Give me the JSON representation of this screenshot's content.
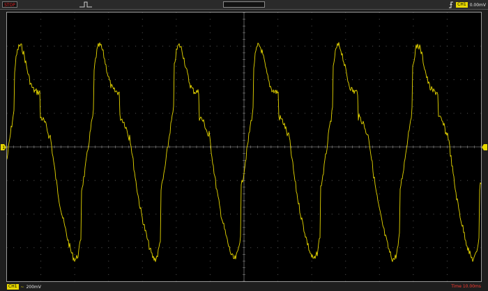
{
  "topbar": {
    "run_state": "STOP",
    "trigger_source": "CH1",
    "trigger_level": "0.00mV",
    "trigger_edge_icon": "rising-edge-icon",
    "trigger_shape_icon": "pulse-icon"
  },
  "bottombar": {
    "channel_badge": "CH1",
    "coupling_symbol": "~",
    "volts_per_div": "200mV",
    "timebase": "Time 10.00ms"
  },
  "colors": {
    "trace": "#e8d800",
    "grid": "#5a5a5a",
    "run_state": "#e02020",
    "timebase": "#ff3b30"
  },
  "waveform": {
    "vertical_divisions": 8,
    "horizontal_divisions": 14,
    "period_divisions": 2.35
  }
}
